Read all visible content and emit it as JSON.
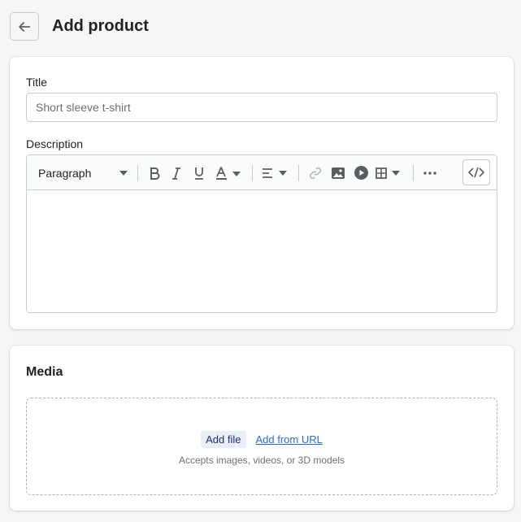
{
  "header": {
    "title": "Add product",
    "back_icon": "arrow-left-icon"
  },
  "product": {
    "title_label": "Title",
    "title_placeholder": "Short sleeve t-shirt",
    "title_value": "",
    "description_label": "Description"
  },
  "toolbar": {
    "format_selected": "Paragraph",
    "icons": [
      "bold-icon",
      "italic-icon",
      "underline-icon",
      "text-color-icon",
      "align-icon",
      "link-icon",
      "image-icon",
      "video-icon",
      "table-icon",
      "more-icon",
      "code-icon"
    ]
  },
  "media": {
    "title": "Media",
    "add_file_label": "Add file",
    "add_url_label": "Add from URL",
    "hint": "Accepts images, videos, or 3D models"
  },
  "colors": {
    "background": "#f6f6f7",
    "card": "#ffffff",
    "border": "#c9cccf",
    "link": "#2c6ecb",
    "muted_text": "#6d7175"
  }
}
